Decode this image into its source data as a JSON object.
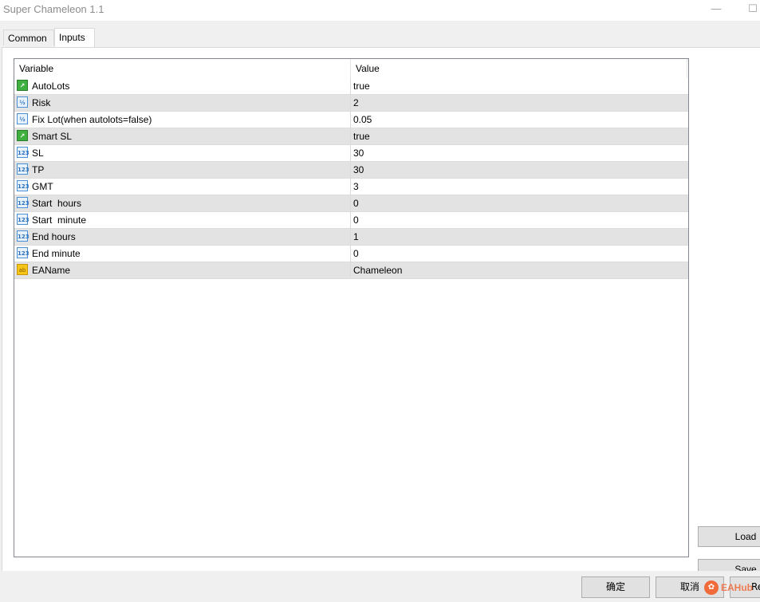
{
  "window": {
    "title": "Super Chameleon 1.1",
    "minimize_glyph": "—",
    "maximize_glyph": "☐"
  },
  "tabs": [
    {
      "label": "Common"
    },
    {
      "label": "Inputs"
    }
  ],
  "grid": {
    "columns": {
      "variable": "Variable",
      "value": "Value"
    },
    "rows": [
      {
        "type": "bool",
        "icon": "bool-icon",
        "glyph": "↗",
        "name": "AutoLots",
        "value": "true"
      },
      {
        "type": "double",
        "icon": "double-icon",
        "glyph": "½",
        "name": "Risk",
        "value": "2"
      },
      {
        "type": "double",
        "icon": "double-icon",
        "glyph": "½",
        "name": "Fix Lot(when autolots=false)",
        "value": "0.05"
      },
      {
        "type": "bool",
        "icon": "bool-icon",
        "glyph": "↗",
        "name": "Smart SL",
        "value": "true"
      },
      {
        "type": "int",
        "icon": "int-icon",
        "glyph": "123",
        "name": "SL",
        "value": "30"
      },
      {
        "type": "int",
        "icon": "int-icon",
        "glyph": "123",
        "name": "TP",
        "value": "30"
      },
      {
        "type": "int",
        "icon": "int-icon",
        "glyph": "123",
        "name": "GMT",
        "value": "3"
      },
      {
        "type": "int",
        "icon": "int-icon",
        "glyph": "123",
        "name": "Start  hours",
        "value": "0"
      },
      {
        "type": "int",
        "icon": "int-icon",
        "glyph": "123",
        "name": "Start  minute",
        "value": "0"
      },
      {
        "type": "int",
        "icon": "int-icon",
        "glyph": "123",
        "name": "End hours",
        "value": "1"
      },
      {
        "type": "int",
        "icon": "int-icon",
        "glyph": "123",
        "name": "End minute",
        "value": "0"
      },
      {
        "type": "string",
        "icon": "string-icon",
        "glyph": "ab",
        "name": "EAName",
        "value": "Chameleon"
      }
    ]
  },
  "side_buttons": {
    "load": "Load",
    "save": "Save"
  },
  "footer": {
    "ok": "确定",
    "cancel": "取消",
    "reset": "Re"
  },
  "watermark": {
    "text": "EAHub"
  },
  "colors": {
    "row_alt": "#e3e3e3",
    "bool_icon": "#3fb03f",
    "int_icon": "#4a90d9",
    "string_icon": "#f5c518"
  }
}
